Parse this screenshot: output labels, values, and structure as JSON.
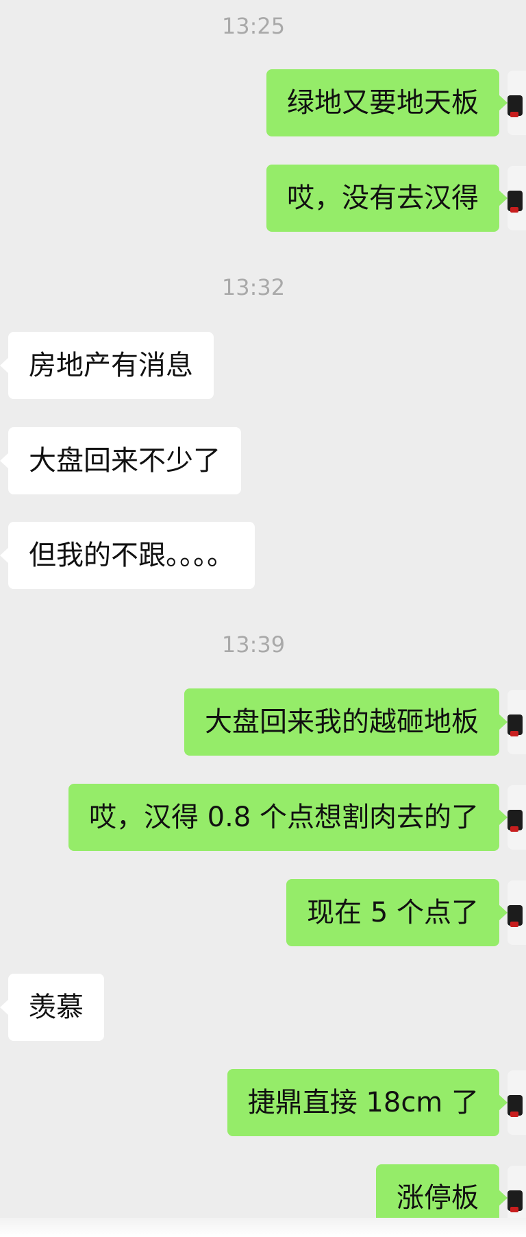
{
  "messages": [
    {
      "type": "time",
      "text": "13:25"
    },
    {
      "type": "sent",
      "text": "绿地又要地天板"
    },
    {
      "type": "sent",
      "text": "哎，没有去汉得"
    },
    {
      "type": "time",
      "text": "13:32"
    },
    {
      "type": "recv",
      "text": "房地产有消息"
    },
    {
      "type": "recv",
      "text": "大盘回来不少了"
    },
    {
      "type": "recv",
      "text": "但我的不跟。。。。"
    },
    {
      "type": "time",
      "text": "13:39"
    },
    {
      "type": "sent",
      "text": "大盘回来我的越砸地板"
    },
    {
      "type": "sent",
      "text": "哎，汉得 0.8 个点想割肉去的了"
    },
    {
      "type": "sent",
      "text": "现在 5 个点了"
    },
    {
      "type": "recv",
      "text": "羡慕"
    },
    {
      "type": "sent",
      "text": "捷鼎直接 18cm 了"
    },
    {
      "type": "sent",
      "text": "涨停板"
    }
  ],
  "colors": {
    "background": "#ededed",
    "sent_bubble": "#95ec69",
    "recv_bubble": "#ffffff",
    "timestamp": "#a9a9a9"
  }
}
